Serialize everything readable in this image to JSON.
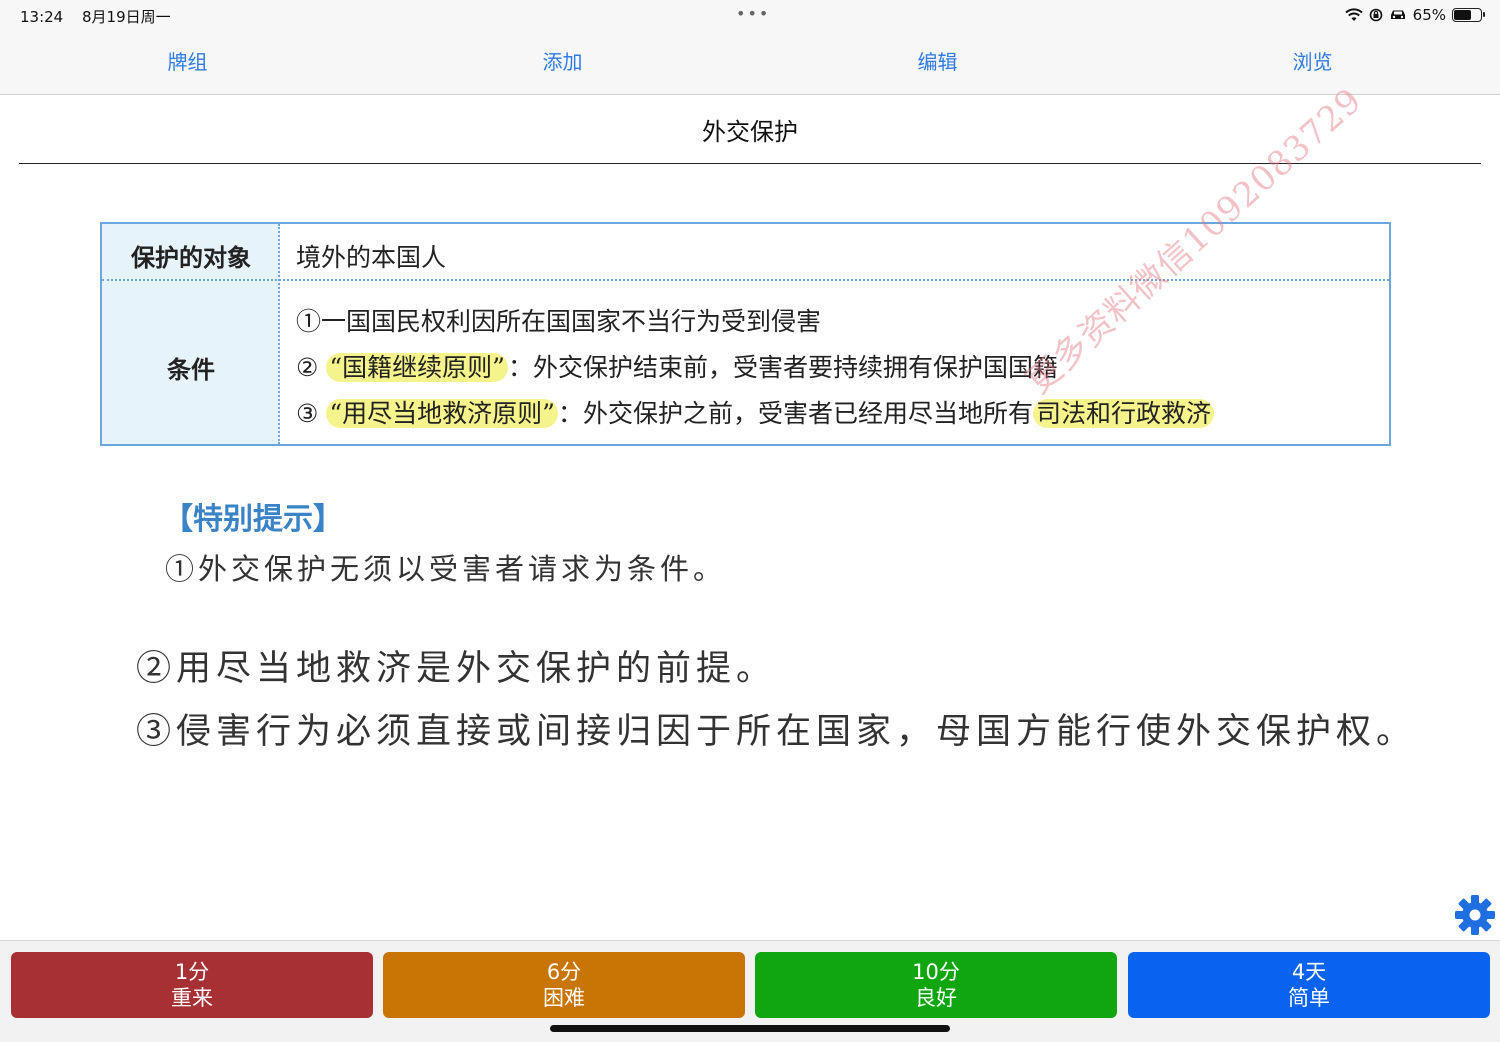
{
  "status_bar": {
    "time": "13:24",
    "date": "8月19日周一",
    "dots": "•••",
    "battery_text": "65%",
    "battery_level": 0.65,
    "icons": [
      "wifi-icon",
      "lock-rotation-icon",
      "car-icon",
      "battery-icon"
    ]
  },
  "tabs": [
    {
      "label": "牌组"
    },
    {
      "label": "添加"
    },
    {
      "label": "编辑"
    },
    {
      "label": "浏览"
    }
  ],
  "card": {
    "title": "外交保护",
    "table": {
      "row1_head": "保护的对象",
      "row1_value": "境外的本国人",
      "row2_head": "条件",
      "cond1": "①一国国民权利因所在国国家不当行为受到侵害",
      "cond2_num": "②",
      "cond2_highlight": "“国籍继续原则”",
      "cond2_rest": "：外交保护结束前，受害者要持续拥有保护国国籍",
      "cond3_num": "③",
      "cond3_highlight": "“用尽当地救济原则”",
      "cond3_rest": "：外交保护之前，受害者已经用尽当地所有",
      "cond3_highlight2": "司法和行政救济"
    },
    "watermark": "更多资料微信1092083729",
    "tips": {
      "heading": "【特别提示】",
      "tip1": "①外交保护无须以受害者请求为条件。",
      "tip2": "②用尽当地救济是外交保护的前提。",
      "tip3": "③侵害行为必须直接或间接归因于所在国家，母国方能行使外交保护权。"
    }
  },
  "settings_icon": "gear-icon",
  "answers": [
    {
      "interval": "1分",
      "label": "重来",
      "color": "#a63034"
    },
    {
      "interval": "6分",
      "label": "困难",
      "color": "#c87505"
    },
    {
      "interval": "10分",
      "label": "良好",
      "color": "#10a610"
    },
    {
      "interval": "4天",
      "label": "简单",
      "color": "#0a63ef"
    }
  ]
}
